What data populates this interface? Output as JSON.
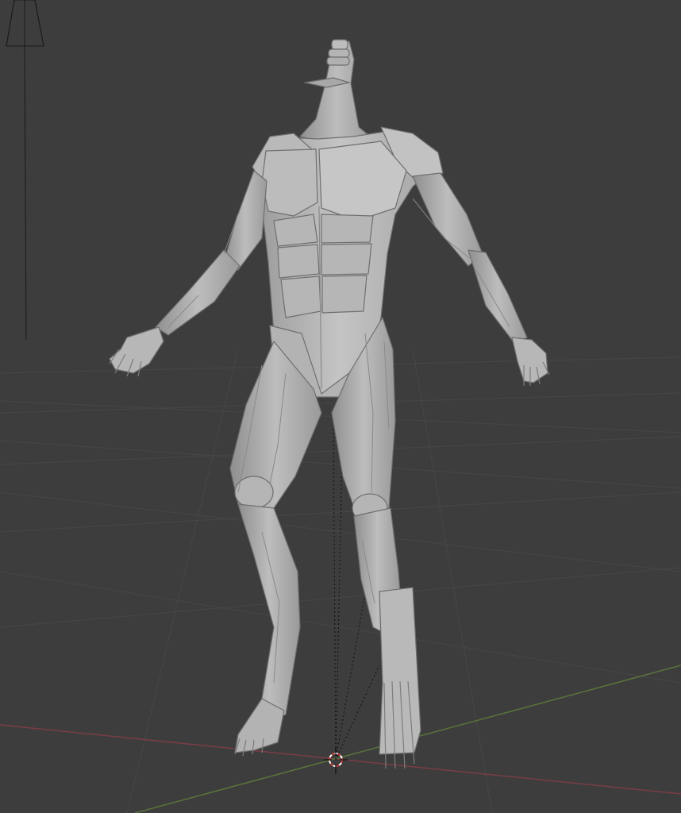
{
  "viewport": {
    "background": "#3d3d3d",
    "grid_color": "#474747",
    "x_axis_color": "#7a3d46",
    "y_axis_color": "#58753a",
    "camera_color": "#1a1a1a",
    "model_color": "#b8b8b8",
    "cursor_colors": [
      "#c83c3c",
      "#ffffff"
    ]
  },
  "objects": [
    {
      "name": "anatomy-model",
      "type": "mesh"
    },
    {
      "name": "camera",
      "type": "camera"
    },
    {
      "name": "3d-cursor",
      "type": "cursor"
    }
  ]
}
